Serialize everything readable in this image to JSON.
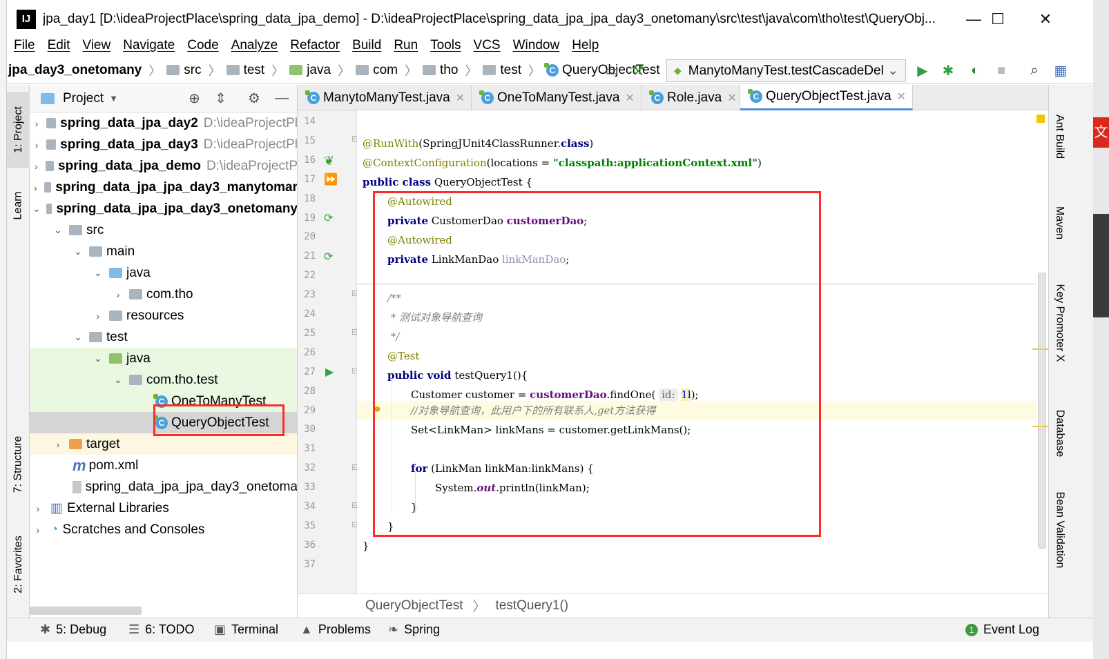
{
  "window": {
    "title": "jpa_day1 [D:\\ideaProjectPlace\\spring_data_jpa_demo] - D:\\ideaProjectPlace\\spring_data_jpa_jpa_day3_onetomany\\src\\test\\java\\com\\tho\\test\\QueryObj...",
    "minimize": "—",
    "maximize": "☐",
    "close": "✕"
  },
  "menu": [
    "File",
    "Edit",
    "View",
    "Navigate",
    "Code",
    "Analyze",
    "Refactor",
    "Build",
    "Run",
    "Tools",
    "VCS",
    "Window",
    "Help"
  ],
  "nav": {
    "crumbs": [
      "jpa_day3_onetomany",
      "src",
      "test",
      "java",
      "com",
      "tho",
      "test",
      "QueryObjectTest"
    ],
    "run_config": "ManytoManyTest.testCascadeDel"
  },
  "left_strip": {
    "project": "1: Project",
    "learn": "Learn",
    "structure": "7: Structure",
    "favorites": "2: Favorites"
  },
  "right_strip": {
    "ant": "Ant Build",
    "maven": "Maven",
    "key_promoter": "Key Promoter X",
    "database": "Database",
    "bean": "Bean Validation"
  },
  "project_panel": {
    "title": "Project",
    "rows": [
      {
        "name": "spring_data_jpa_day2",
        "path": "D:\\ideaProjectPl"
      },
      {
        "name": "spring_data_jpa_day3",
        "path": "D:\\ideaProjectPl"
      },
      {
        "name": "spring_data_jpa_demo",
        "path": "D:\\ideaProjectP"
      },
      {
        "name": "spring_data_jpa_jpa_day3_manytomar",
        "path": ""
      },
      {
        "name": "spring_data_jpa_jpa_day3_onetomany",
        "path": ""
      },
      {
        "name": "src"
      },
      {
        "name": "main"
      },
      {
        "name": "java"
      },
      {
        "name": "com.tho"
      },
      {
        "name": "resources"
      },
      {
        "name": "test"
      },
      {
        "name": "java"
      },
      {
        "name": "com.tho.test"
      },
      {
        "name": "OneToManyTest"
      },
      {
        "name": "QueryObjectTest"
      },
      {
        "name": "target"
      },
      {
        "name": "pom.xml"
      },
      {
        "name": "spring_data_jpa_jpa_day3_onetoma"
      },
      {
        "name": "External Libraries"
      },
      {
        "name": "Scratches and Consoles"
      }
    ]
  },
  "editor_tabs": [
    "ManytoManyTest.java",
    "OneToManyTest.java",
    "Role.java",
    "QueryObjectTest.java"
  ],
  "line_numbers": [
    "14",
    "15",
    "16",
    "17",
    "18",
    "19",
    "20",
    "21",
    "22",
    "23",
    "24",
    "25",
    "26",
    "27",
    "28",
    "29",
    "30",
    "31",
    "32",
    "33",
    "34",
    "35",
    "36",
    "37"
  ],
  "code": {
    "l15_ann": "@RunWith",
    "l15_rest": "(SpringJUnit4ClassRunner.",
    "l15_kw": "class",
    "l15_end": ")",
    "l16_ann": "@ContextConfiguration",
    "l16_rest": "(locations = ",
    "l16_str": "\"classpath:applicationContext.xml\"",
    "l16_end": ")",
    "l17_kw": "public class",
    "l17_rest": " QueryObjectTest {",
    "l18_ann": "@Autowired",
    "l19_kw": "private",
    "l19_type": " CustomerDao ",
    "l19_fld": "customerDao",
    "l19_end": ";",
    "l20_ann": "@Autowired",
    "l21_kw": "private",
    "l21_type": " LinkManDao ",
    "l21_fld": "linkManDao",
    "l21_end": ";",
    "l23": "/**",
    "l24": " * 测试对象导航查询",
    "l25": " */",
    "l26_ann": "@Test",
    "l27_kw": "public void",
    "l27_rest": " testQuery1(){",
    "l28_a": "Customer customer = ",
    "l28_fld": "customerDao",
    "l28_b": ".findOne(",
    "l28_hint": "id:",
    "l28_num": "1l",
    "l28_end": ");",
    "l29": "//对象导航查询，此用户下的所有联系人,get方法获得",
    "l30": "Set<LinkMan> linkMans = customer.getLinkMans();",
    "l32_kw": "for",
    "l32_rest": " (LinkMan linkMan:linkMans) {",
    "l33_a": "System.",
    "l33_out": "out",
    "l33_b": ".println(linkMan);",
    "l34": "}",
    "l35": "}",
    "l36": "}"
  },
  "bottom_breadcrumb": [
    "QueryObjectTest",
    "testQuery1()"
  ],
  "statusbar": {
    "debug": "5: Debug",
    "todo": "6: TODO",
    "terminal": "Terminal",
    "problems": "Problems",
    "spring": "Spring",
    "event_log": "Event Log",
    "event_count": "1"
  },
  "colors": {
    "highlight_box": "#ff2a2a",
    "keyword": "#000080",
    "annotation": "#808000",
    "field": "#660e7a",
    "string": "#008000"
  }
}
